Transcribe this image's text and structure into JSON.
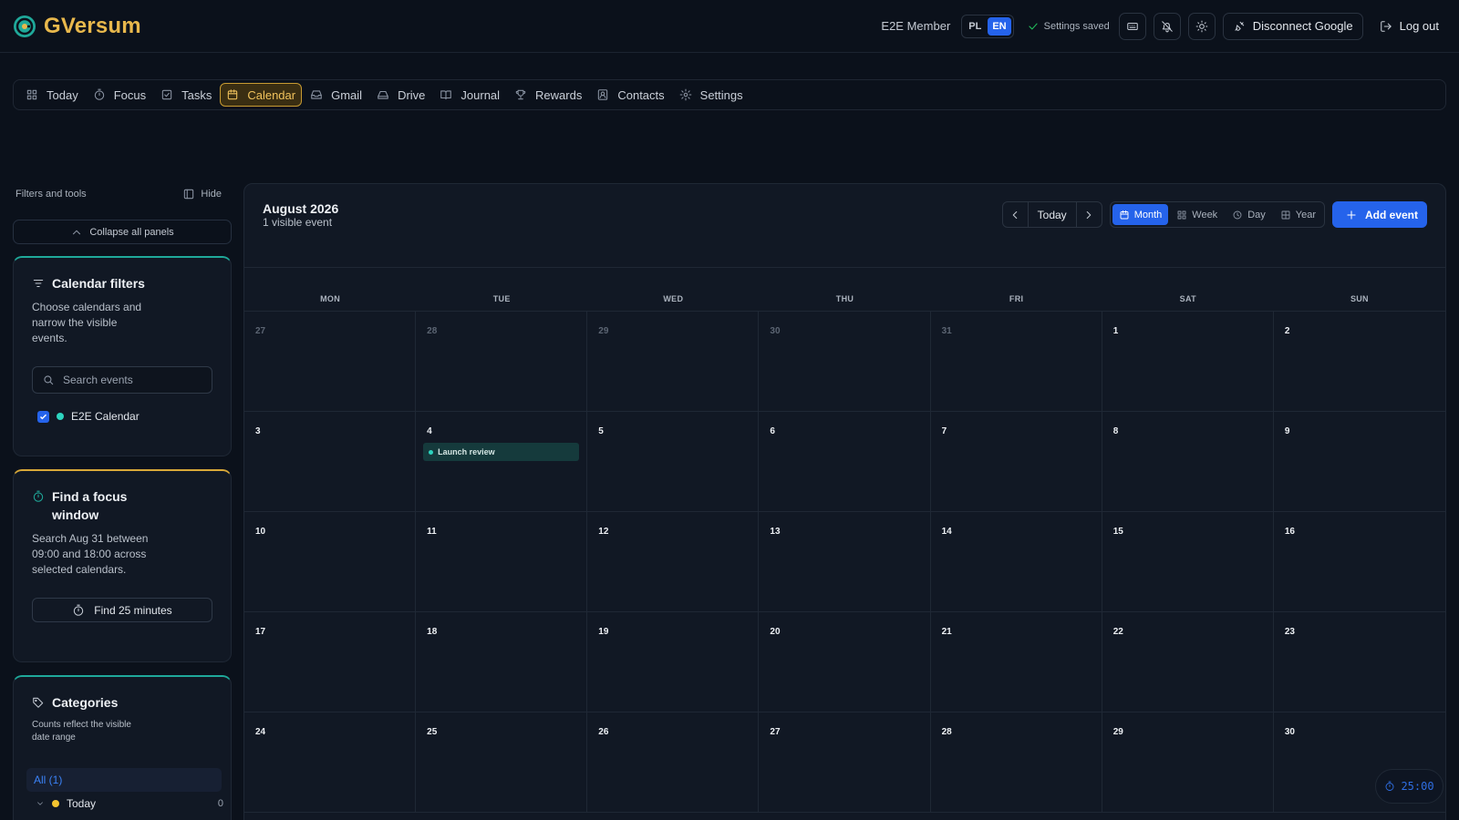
{
  "brand": {
    "name": "GVersum"
  },
  "header": {
    "member": "E2E Member",
    "lang": [
      "PL",
      "EN"
    ],
    "lang_active": "EN",
    "saved": "Settings saved",
    "disconnect": "Disconnect Google",
    "logout": "Log out"
  },
  "nav": [
    {
      "label": "Today",
      "icon": "grid-icon"
    },
    {
      "label": "Focus",
      "icon": "timer-icon"
    },
    {
      "label": "Tasks",
      "icon": "checkbox-icon"
    },
    {
      "label": "Calendar",
      "icon": "calendar-icon",
      "active": true
    },
    {
      "label": "Gmail",
      "icon": "inbox-icon"
    },
    {
      "label": "Drive",
      "icon": "drive-icon"
    },
    {
      "label": "Journal",
      "icon": "book-icon"
    },
    {
      "label": "Rewards",
      "icon": "trophy-icon"
    },
    {
      "label": "Contacts",
      "icon": "contact-icon"
    },
    {
      "label": "Settings",
      "icon": "gear-icon"
    }
  ],
  "sidebar": {
    "title": "Filters and tools",
    "hide": "Hide",
    "collapse": "Collapse all panels",
    "filters": {
      "title": "Calendar filters",
      "desc": "Choose calendars and narrow the visible events.",
      "search_placeholder": "Search events",
      "calendar": {
        "name": "E2E Calendar",
        "checked": true,
        "color": "#2dd4bf"
      }
    },
    "focus": {
      "title": "Find a focus window",
      "desc": "Search Aug 31 between 09:00 and 18:00 across selected calendars.",
      "button": "Find 25 minutes"
    },
    "categories": {
      "title": "Categories",
      "desc": "Counts reflect the visible date range",
      "all": "All (1)",
      "items": [
        {
          "label": "Today",
          "count": "0",
          "color": "#f4c430"
        }
      ]
    }
  },
  "calendar": {
    "title": "August 2026",
    "subtitle": "1 visible event",
    "today": "Today",
    "views": [
      "Month",
      "Week",
      "Day",
      "Year"
    ],
    "active_view": "Month",
    "add_event": "Add event",
    "weekdays": [
      "MON",
      "TUE",
      "WED",
      "THU",
      "FRI",
      "SAT",
      "SUN"
    ],
    "weeks": [
      [
        {
          "d": "27",
          "muted": true
        },
        {
          "d": "28",
          "muted": true
        },
        {
          "d": "29",
          "muted": true
        },
        {
          "d": "30",
          "muted": true
        },
        {
          "d": "31",
          "muted": true
        },
        {
          "d": "1"
        },
        {
          "d": "2"
        }
      ],
      [
        {
          "d": "3"
        },
        {
          "d": "4",
          "event": "Launch review"
        },
        {
          "d": "5"
        },
        {
          "d": "6"
        },
        {
          "d": "7"
        },
        {
          "d": "8"
        },
        {
          "d": "9"
        }
      ],
      [
        {
          "d": "10"
        },
        {
          "d": "11"
        },
        {
          "d": "12"
        },
        {
          "d": "13"
        },
        {
          "d": "14"
        },
        {
          "d": "15"
        },
        {
          "d": "16"
        }
      ],
      [
        {
          "d": "17"
        },
        {
          "d": "18"
        },
        {
          "d": "19"
        },
        {
          "d": "20"
        },
        {
          "d": "21"
        },
        {
          "d": "22"
        },
        {
          "d": "23"
        }
      ],
      [
        {
          "d": "24"
        },
        {
          "d": "25"
        },
        {
          "d": "26"
        },
        {
          "d": "27"
        },
        {
          "d": "28"
        },
        {
          "d": "29"
        },
        {
          "d": "30"
        }
      ]
    ]
  },
  "timer": "25:00",
  "colors": {
    "accent": "#2563eb",
    "brand": "#e8b84c",
    "event": "#2dd4bf"
  }
}
